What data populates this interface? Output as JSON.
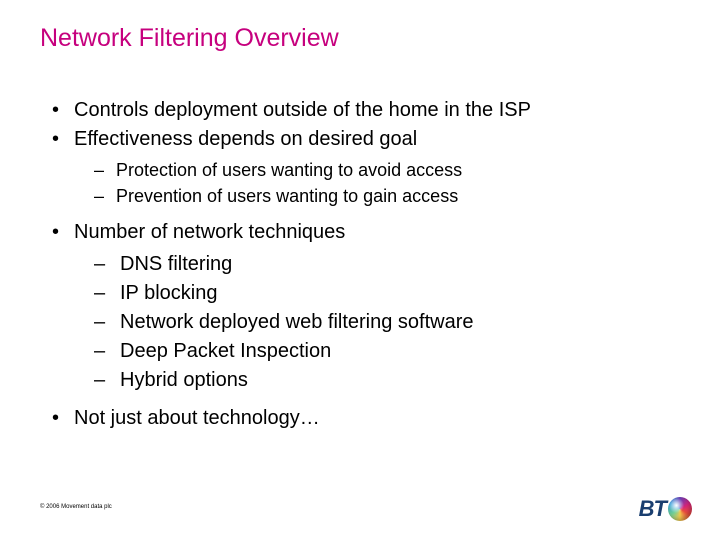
{
  "title": "Network Filtering Overview",
  "bullets": {
    "b1": "Controls deployment outside of the home in the ISP",
    "b2": "Effectiveness depends on desired goal",
    "b2_sub": {
      "s1": "Protection of users wanting to avoid access",
      "s2": "Prevention of users wanting to gain access"
    },
    "b3": "Number of network techniques",
    "b3_sub": {
      "s1": "DNS filtering",
      "s2": "IP blocking",
      "s3": "Network deployed web filtering software",
      "s4": "Deep Packet Inspection",
      "s5": "Hybrid options"
    },
    "b4": "Not just about technology…"
  },
  "footer": "© 2006 Movement data plc",
  "logo_text": "BT"
}
